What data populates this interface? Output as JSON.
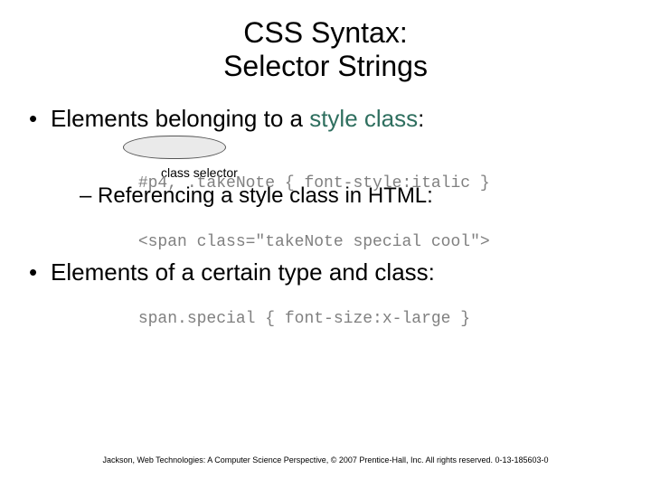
{
  "title": {
    "line1": "CSS Syntax:",
    "line2": "Selector Strings"
  },
  "bullets": {
    "b1_prefix": "Elements belonging to a ",
    "b1_styleclass": "style class",
    "b1_suffix": ":",
    "code1": "#p4, .takeNote { font-style:italic }",
    "caption1": "class selector",
    "b2": "– Referencing a style class in HTML:",
    "code2": "<span class=\"takeNote special cool\">",
    "b3": "Elements of a certain type and class:",
    "code3": "span.special { font-size:x-large }"
  },
  "footer": "Jackson, Web Technologies: A Computer Science Perspective, © 2007 Prentice-Hall, Inc. All rights reserved. 0-13-185603-0"
}
